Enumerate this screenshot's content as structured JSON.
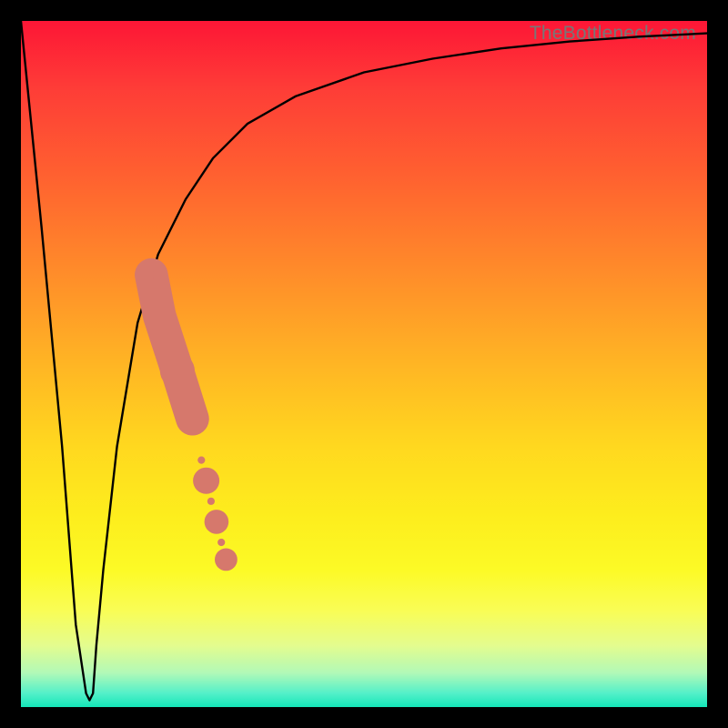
{
  "watermark": "TheBottleneck.com",
  "chart_data": {
    "type": "line",
    "title": "",
    "xlabel": "",
    "ylabel": "",
    "xlim": [
      0,
      100
    ],
    "ylim": [
      0,
      100
    ],
    "series": [
      {
        "name": "bottleneck-curve",
        "x": [
          0,
          3,
          6,
          8,
          9.5,
          10,
          10.5,
          11,
          12,
          14,
          17,
          20,
          24,
          28,
          33,
          40,
          50,
          60,
          70,
          80,
          90,
          100
        ],
        "values": [
          100,
          70,
          38,
          12,
          2,
          1,
          2,
          9,
          20,
          38,
          56,
          66,
          74,
          80,
          85,
          89,
          92.5,
          94.5,
          96,
          97,
          97.7,
          98.2
        ]
      }
    ],
    "highlight_points": {
      "name": "highlighted-range",
      "color": "#d6786c",
      "points": [
        {
          "x": 19.0,
          "y": 63,
          "r": 1.0
        },
        {
          "x": 20.2,
          "y": 57,
          "r": 4.2
        },
        {
          "x": 22.8,
          "y": 49,
          "r": 4.6
        },
        {
          "x": 25.0,
          "y": 42,
          "r": 4.2
        },
        {
          "x": 26.3,
          "y": 36,
          "r": 1.0
        },
        {
          "x": 27.0,
          "y": 33,
          "r": 3.5
        },
        {
          "x": 27.7,
          "y": 30,
          "r": 1.0
        },
        {
          "x": 28.5,
          "y": 27,
          "r": 3.2
        },
        {
          "x": 29.2,
          "y": 24,
          "r": 1.0
        },
        {
          "x": 29.9,
          "y": 21.5,
          "r": 3.0
        }
      ]
    },
    "gradient_stops": [
      {
        "pos": 0,
        "color": "#fd1636"
      },
      {
        "pos": 10,
        "color": "#fe3d37"
      },
      {
        "pos": 22,
        "color": "#ff5f30"
      },
      {
        "pos": 36,
        "color": "#ff8a2a"
      },
      {
        "pos": 50,
        "color": "#ffb524"
      },
      {
        "pos": 62,
        "color": "#ffd81f"
      },
      {
        "pos": 72,
        "color": "#fded1d"
      },
      {
        "pos": 80,
        "color": "#fcfa26"
      },
      {
        "pos": 86,
        "color": "#f9fd56"
      },
      {
        "pos": 91,
        "color": "#e4fc8e"
      },
      {
        "pos": 95,
        "color": "#b2f9b7"
      },
      {
        "pos": 98,
        "color": "#53f0c9"
      },
      {
        "pos": 100,
        "color": "#14e6b8"
      }
    ]
  }
}
